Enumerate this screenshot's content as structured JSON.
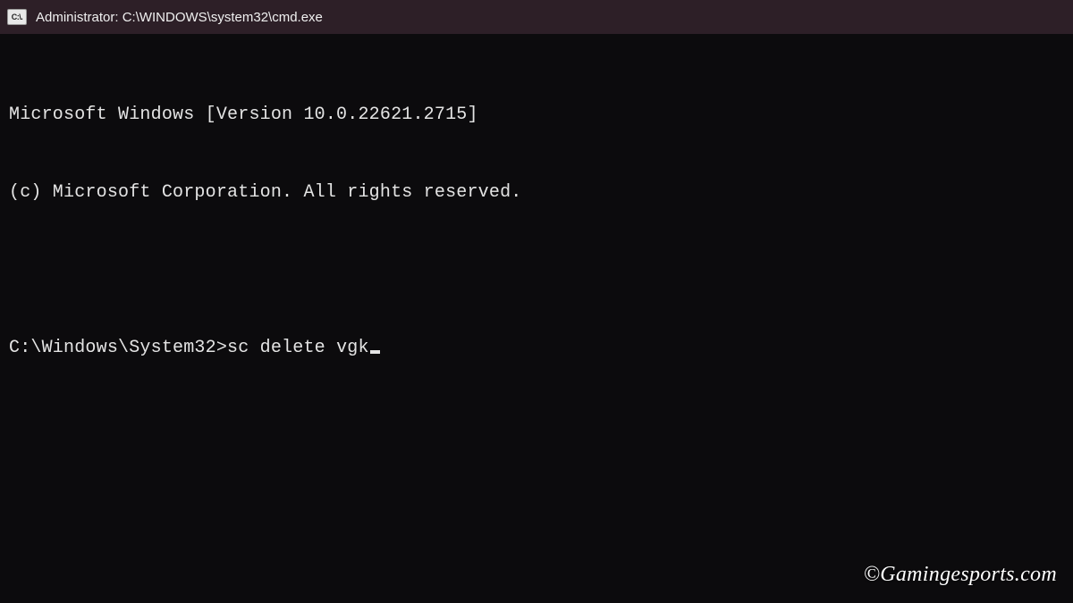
{
  "titlebar": {
    "icon_label": "C:\\.",
    "title": "Administrator: C:\\WINDOWS\\system32\\cmd.exe"
  },
  "terminal": {
    "line1": "Microsoft Windows [Version 10.0.22621.2715]",
    "line2": "(c) Microsoft Corporation. All rights reserved.",
    "prompt": "C:\\Windows\\System32>",
    "command": "sc delete vgk"
  },
  "watermark": "©Gamingesports.com"
}
